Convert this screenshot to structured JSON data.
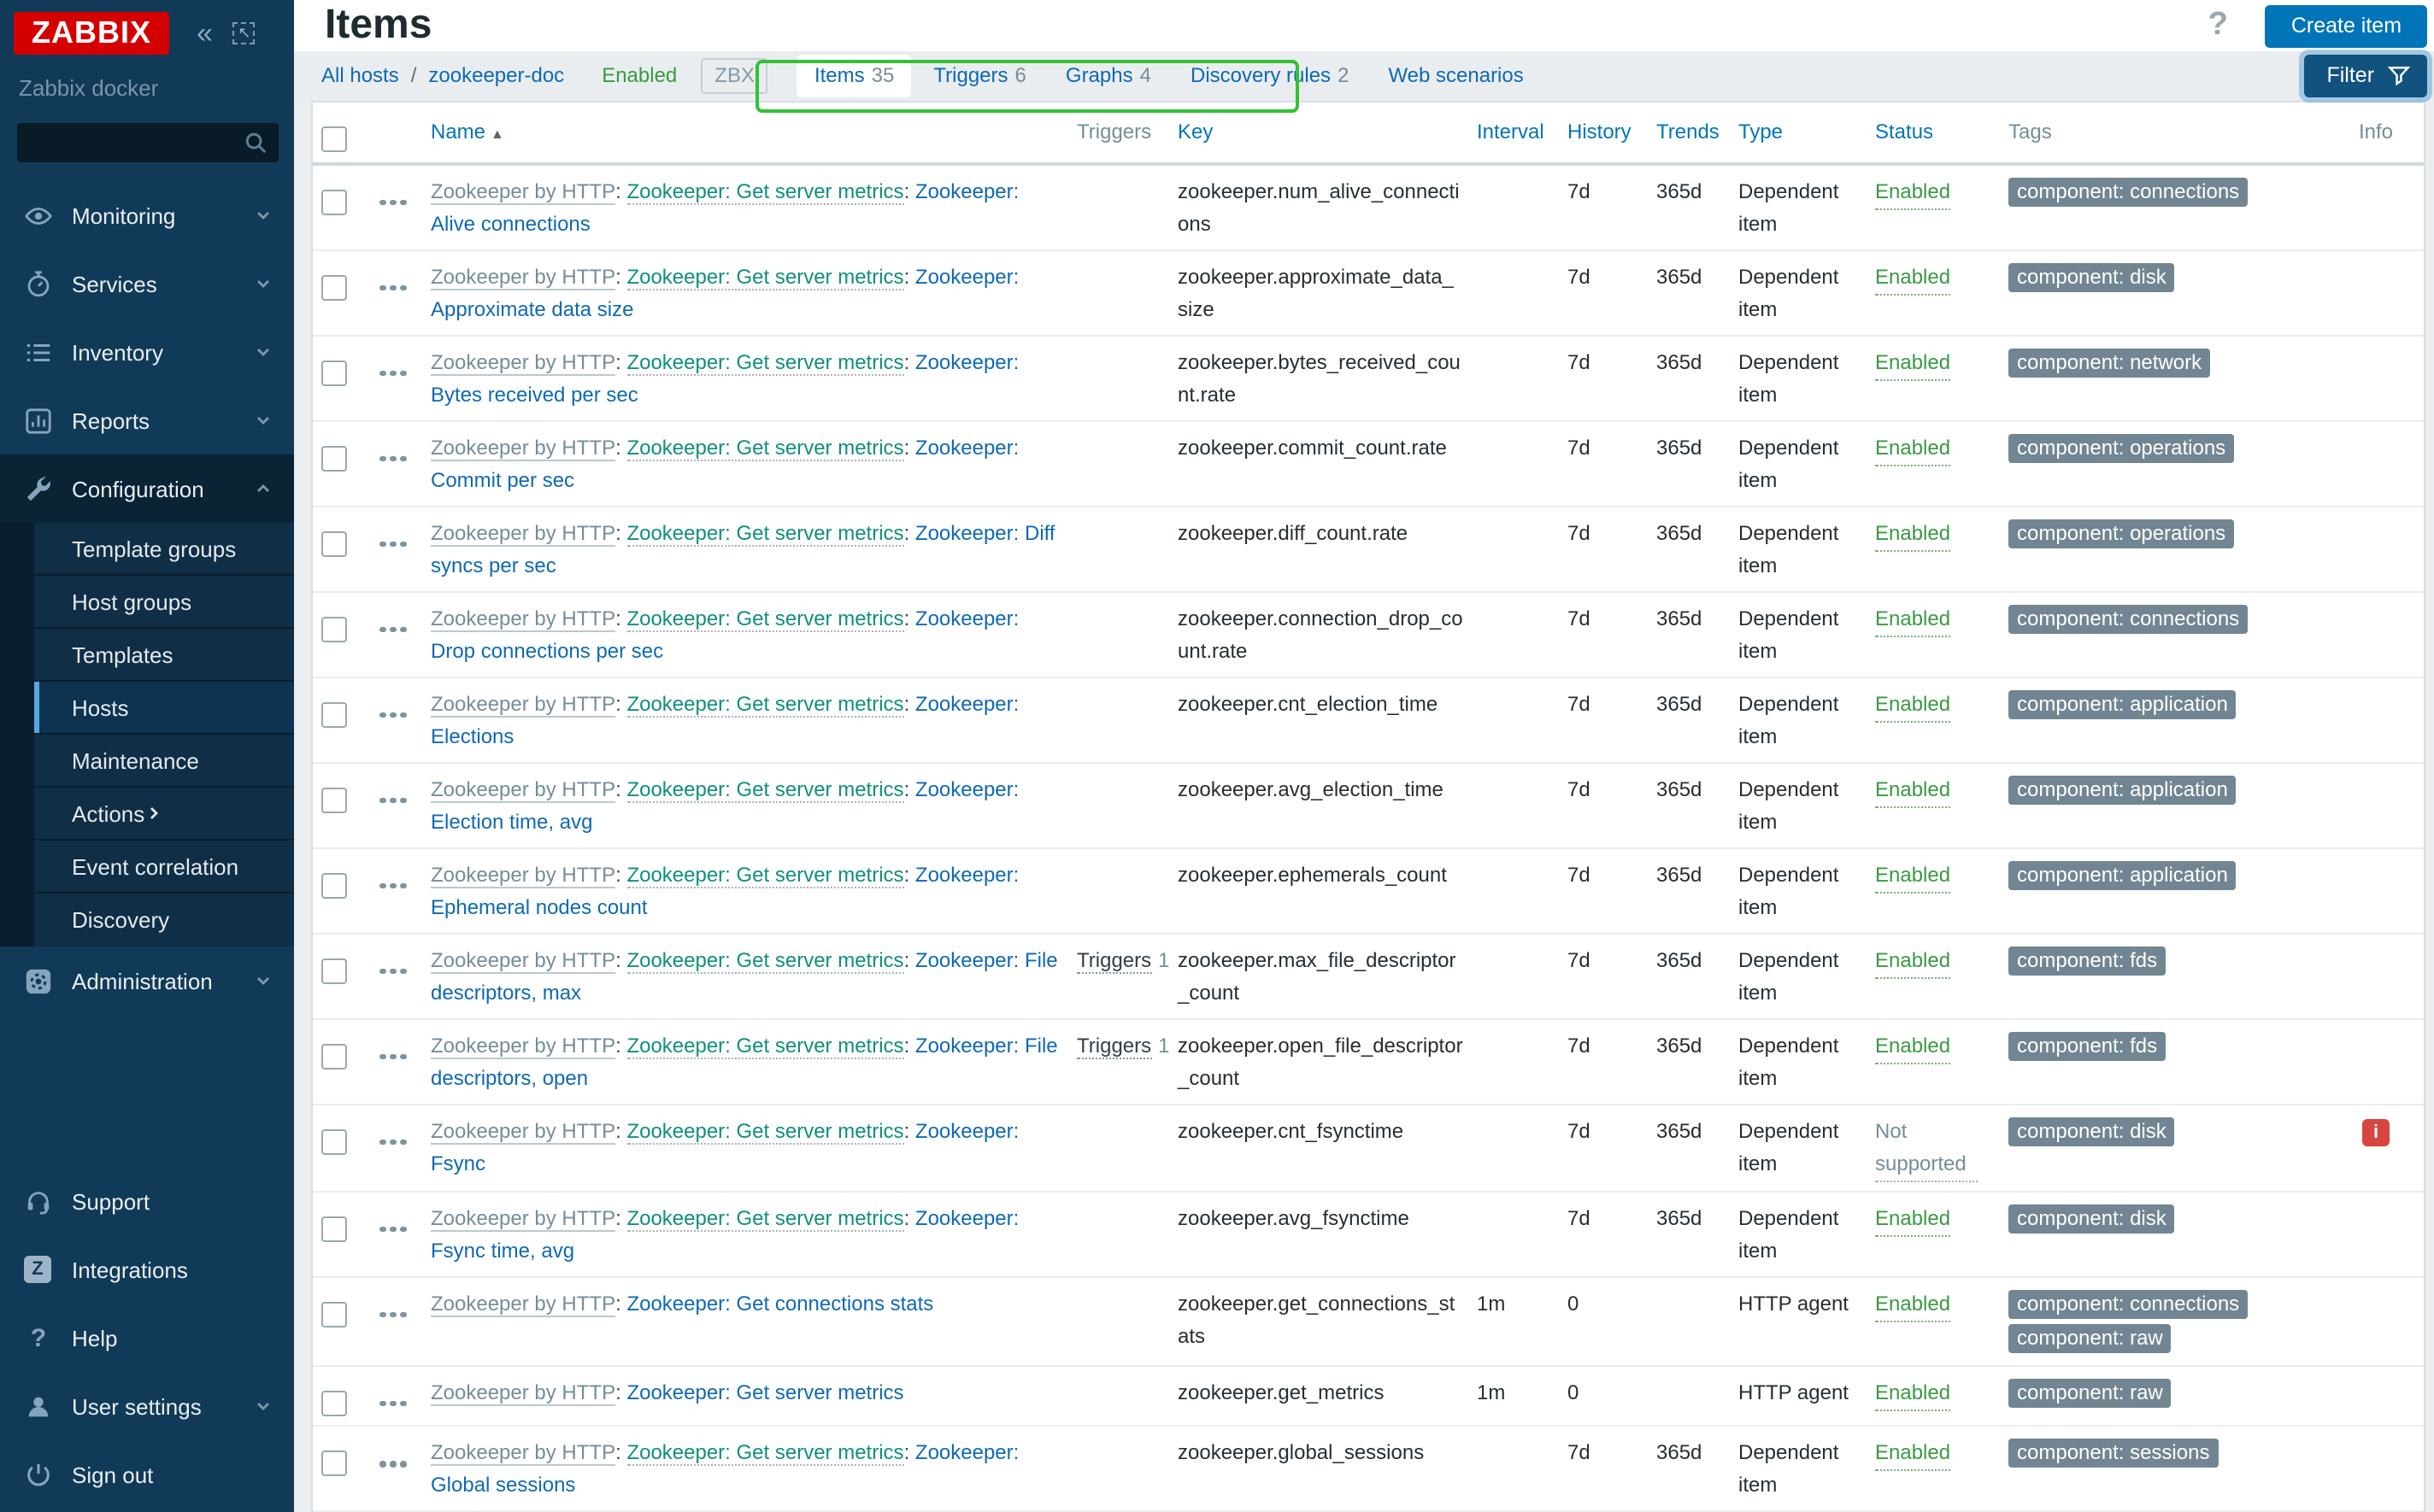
{
  "sidebar": {
    "logo": "ZABBIX",
    "server_name": "Zabbix docker",
    "search": {
      "value": "",
      "placeholder": ""
    },
    "menu": [
      {
        "label": "Monitoring",
        "icon": "eye-icon",
        "chevron": "down"
      },
      {
        "label": "Services",
        "icon": "stopwatch-icon",
        "chevron": "down"
      },
      {
        "label": "Inventory",
        "icon": "list-icon",
        "chevron": "down"
      },
      {
        "label": "Reports",
        "icon": "report-icon",
        "chevron": "down"
      },
      {
        "label": "Configuration",
        "icon": "wrench-icon",
        "chevron": "up",
        "expanded": true,
        "submenu": [
          {
            "label": "Template groups"
          },
          {
            "label": "Host groups"
          },
          {
            "label": "Templates"
          },
          {
            "label": "Hosts",
            "active": true
          },
          {
            "label": "Maintenance"
          },
          {
            "label": "Actions",
            "chevron": "right"
          },
          {
            "label": "Event correlation"
          },
          {
            "label": "Discovery"
          }
        ]
      },
      {
        "label": "Administration",
        "icon": "gear-icon",
        "chevron": "down"
      }
    ],
    "footer": [
      {
        "label": "Support",
        "icon": "headset-icon"
      },
      {
        "label": "Integrations",
        "icon": "z-icon"
      },
      {
        "label": "Help",
        "icon": "question-icon"
      },
      {
        "label": "User settings",
        "icon": "user-icon",
        "chevron": "down"
      },
      {
        "label": "Sign out",
        "icon": "power-icon"
      }
    ]
  },
  "header": {
    "title": "Items",
    "help_icon": "?",
    "create_button": "Create item"
  },
  "toolbar": {
    "breadcrumb": {
      "all_hosts": "All hosts",
      "separator": "/",
      "host": "zookeeper-doc"
    },
    "host_status": "Enabled",
    "zbx_badge": "ZBX",
    "tabs": [
      {
        "label": "Items",
        "count": "35",
        "active": true
      },
      {
        "label": "Triggers",
        "count": "6"
      },
      {
        "label": "Graphs",
        "count": "4"
      },
      {
        "label": "Discovery rules",
        "count": "2"
      },
      {
        "label": "Web scenarios",
        "count": ""
      }
    ],
    "filter_button": "Filter"
  },
  "table": {
    "columns": {
      "name": "Name",
      "triggers": "Triggers",
      "key": "Key",
      "interval": "Interval",
      "history": "History",
      "trends": "Trends",
      "type": "Type",
      "status": "Status",
      "tags": "Tags",
      "info": "Info"
    },
    "sort_arrow": "▲",
    "rows": [
      {
        "template": "Zookeeper by HTTP",
        "master": "Zookeeper: Get server metrics",
        "item": "Zookeeper: Alive connections",
        "triggers": null,
        "key": "zookeeper.num_alive_connections",
        "interval": "",
        "history": "7d",
        "trends": "365d",
        "type": "Dependent item",
        "status": "Enabled",
        "status_kind": "enabled",
        "tags": [
          "component: connections"
        ],
        "info": false
      },
      {
        "template": "Zookeeper by HTTP",
        "master": "Zookeeper: Get server metrics",
        "item": "Zookeeper: Approximate data size",
        "triggers": null,
        "key": "zookeeper.approximate_data_size",
        "interval": "",
        "history": "7d",
        "trends": "365d",
        "type": "Dependent item",
        "status": "Enabled",
        "status_kind": "enabled",
        "tags": [
          "component: disk"
        ],
        "info": false
      },
      {
        "template": "Zookeeper by HTTP",
        "master": "Zookeeper: Get server metrics",
        "item": "Zookeeper: Bytes received per sec",
        "triggers": null,
        "key": "zookeeper.bytes_received_count.rate",
        "interval": "",
        "history": "7d",
        "trends": "365d",
        "type": "Dependent item",
        "status": "Enabled",
        "status_kind": "enabled",
        "tags": [
          "component: network"
        ],
        "info": false
      },
      {
        "template": "Zookeeper by HTTP",
        "master": "Zookeeper: Get server metrics",
        "item": "Zookeeper: Commit per sec",
        "triggers": null,
        "key": "zookeeper.commit_count.rate",
        "interval": "",
        "history": "7d",
        "trends": "365d",
        "type": "Dependent item",
        "status": "Enabled",
        "status_kind": "enabled",
        "tags": [
          "component: operations"
        ],
        "info": false
      },
      {
        "template": "Zookeeper by HTTP",
        "master": "Zookeeper: Get server metrics",
        "item": "Zookeeper: Diff syncs per sec",
        "triggers": null,
        "key": "zookeeper.diff_count.rate",
        "interval": "",
        "history": "7d",
        "trends": "365d",
        "type": "Dependent item",
        "status": "Enabled",
        "status_kind": "enabled",
        "tags": [
          "component: operations"
        ],
        "info": false
      },
      {
        "template": "Zookeeper by HTTP",
        "master": "Zookeeper: Get server metrics",
        "item": "Zookeeper: Drop connections per sec",
        "triggers": null,
        "key": "zookeeper.connection_drop_count.rate",
        "interval": "",
        "history": "7d",
        "trends": "365d",
        "type": "Dependent item",
        "status": "Enabled",
        "status_kind": "enabled",
        "tags": [
          "component: connections"
        ],
        "info": false
      },
      {
        "template": "Zookeeper by HTTP",
        "master": "Zookeeper: Get server metrics",
        "item": "Zookeeper: Elections",
        "triggers": null,
        "key": "zookeeper.cnt_election_time",
        "interval": "",
        "history": "7d",
        "trends": "365d",
        "type": "Dependent item",
        "status": "Enabled",
        "status_kind": "enabled",
        "tags": [
          "component: application"
        ],
        "info": false
      },
      {
        "template": "Zookeeper by HTTP",
        "master": "Zookeeper: Get server metrics",
        "item": "Zookeeper: Election time, avg",
        "triggers": null,
        "key": "zookeeper.avg_election_time",
        "interval": "",
        "history": "7d",
        "trends": "365d",
        "type": "Dependent item",
        "status": "Enabled",
        "status_kind": "enabled",
        "tags": [
          "component: application"
        ],
        "info": false
      },
      {
        "template": "Zookeeper by HTTP",
        "master": "Zookeeper: Get server metrics",
        "item": "Zookeeper: Ephemeral nodes count",
        "triggers": null,
        "key": "zookeeper.ephemerals_count",
        "interval": "",
        "history": "7d",
        "trends": "365d",
        "type": "Dependent item",
        "status": "Enabled",
        "status_kind": "enabled",
        "tags": [
          "component: application"
        ],
        "info": false
      },
      {
        "template": "Zookeeper by HTTP",
        "master": "Zookeeper: Get server metrics",
        "item": "Zookeeper: File descriptors, max",
        "triggers": {
          "label": "Triggers",
          "count": "1"
        },
        "key": "zookeeper.max_file_descriptor_count",
        "interval": "",
        "history": "7d",
        "trends": "365d",
        "type": "Dependent item",
        "status": "Enabled",
        "status_kind": "enabled",
        "tags": [
          "component: fds"
        ],
        "info": false
      },
      {
        "template": "Zookeeper by HTTP",
        "master": "Zookeeper: Get server metrics",
        "item": "Zookeeper: File descriptors, open",
        "triggers": {
          "label": "Triggers",
          "count": "1"
        },
        "key": "zookeeper.open_file_descriptor_count",
        "interval": "",
        "history": "7d",
        "trends": "365d",
        "type": "Dependent item",
        "status": "Enabled",
        "status_kind": "enabled",
        "tags": [
          "component: fds"
        ],
        "info": false
      },
      {
        "template": "Zookeeper by HTTP",
        "master": "Zookeeper: Get server metrics",
        "item": "Zookeeper: Fsync",
        "triggers": null,
        "key": "zookeeper.cnt_fsynctime",
        "interval": "",
        "history": "7d",
        "trends": "365d",
        "type": "Dependent item",
        "status": "Not supported",
        "status_kind": "notsupported",
        "tags": [
          "component: disk"
        ],
        "info": true
      },
      {
        "template": "Zookeeper by HTTP",
        "master": "Zookeeper: Get server metrics",
        "item": "Zookeeper: Fsync time, avg",
        "triggers": null,
        "key": "zookeeper.avg_fsynctime",
        "interval": "",
        "history": "7d",
        "trends": "365d",
        "type": "Dependent item",
        "status": "Enabled",
        "status_kind": "enabled",
        "tags": [
          "component: disk"
        ],
        "info": false
      },
      {
        "template": "Zookeeper by HTTP",
        "master": null,
        "item": "Zookeeper: Get connections stats",
        "triggers": null,
        "key": "zookeeper.get_connections_stats",
        "interval": "1m",
        "history": "0",
        "trends": "",
        "type": "HTTP agent",
        "status": "Enabled",
        "status_kind": "enabled",
        "tags": [
          "component: connections",
          "component: raw"
        ],
        "info": false
      },
      {
        "template": "Zookeeper by HTTP",
        "master": null,
        "item": "Zookeeper: Get server metrics",
        "triggers": null,
        "key": "zookeeper.get_metrics",
        "interval": "1m",
        "history": "0",
        "trends": "",
        "type": "HTTP agent",
        "status": "Enabled",
        "status_kind": "enabled",
        "tags": [
          "component: raw"
        ],
        "info": false
      },
      {
        "template": "Zookeeper by HTTP",
        "master": "Zookeeper: Get server metrics",
        "item": "Zookeeper: Global sessions",
        "triggers": null,
        "key": "zookeeper.global_sessions",
        "interval": "",
        "history": "7d",
        "trends": "365d",
        "type": "Dependent item",
        "status": "Enabled",
        "status_kind": "enabled",
        "tags": [
          "component: sessions"
        ],
        "info": false
      }
    ]
  },
  "colors": {
    "accent_blue": "#0275b8",
    "link_blue": "#0f69b4",
    "green": "#3a9a43",
    "teal_link": "#10907a",
    "gray_link": "#768d99",
    "tag_gray": "#718692",
    "error_red": "#d64540",
    "annotation_green": "#33c133",
    "sidebar_navy": "#113a58",
    "logo_red": "#d40000"
  }
}
